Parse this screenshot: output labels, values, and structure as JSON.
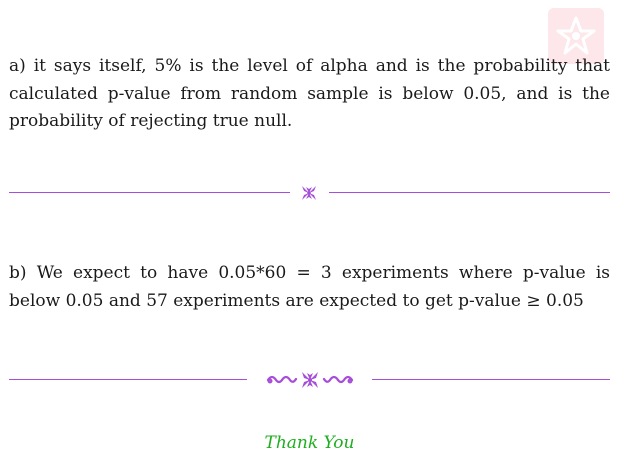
{
  "answers": {
    "a": "a) it says itself, 5% is the level of alpha and is the probability that calculated p-value from random sample is below 0.05, and is the probability of rejecting true null.",
    "b": "b) We expect to have 0.05*60 = 3 experiments where p-value is below 0.05 and 57 experiments are expected to get p-value ≥ 0.05"
  },
  "closing": "Thank You",
  "colors": {
    "ornament": "#a64ed9",
    "closing": "#1fae1f",
    "watermark": "#fde7ea"
  },
  "icons": {
    "watermark": "star-logo-icon",
    "divider_1": "flower-ornament-icon",
    "divider_2": "floral-flourish-icon"
  }
}
